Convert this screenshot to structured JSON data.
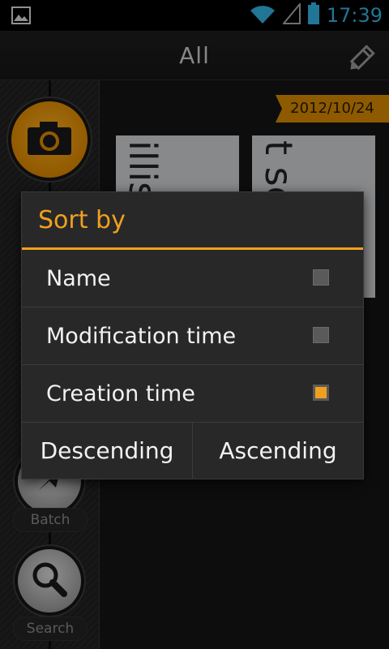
{
  "status_bar": {
    "time": "17:39",
    "icons": [
      "image-icon",
      "wifi-icon",
      "signal-icon",
      "battery-icon"
    ]
  },
  "action_bar": {
    "title": "All",
    "edit_icon": "pencil-icon"
  },
  "sidebar": {
    "camera_icon": "camera-icon",
    "batch_label": "Batch",
    "search_label": "Search"
  },
  "content": {
    "date": "2012/10/24",
    "thumbs": [
      {
        "text": "illis  on"
      },
      {
        "text": "t se  age"
      }
    ]
  },
  "dialog": {
    "title": "Sort by",
    "options": [
      {
        "label": "Name",
        "checked": false
      },
      {
        "label": "Modification time",
        "checked": false
      },
      {
        "label": "Creation time",
        "checked": true
      }
    ],
    "buttons": {
      "descending": "Descending",
      "ascending": "Ascending"
    }
  },
  "colors": {
    "accent": "#f0a020",
    "status_blue": "#33b5e5"
  }
}
